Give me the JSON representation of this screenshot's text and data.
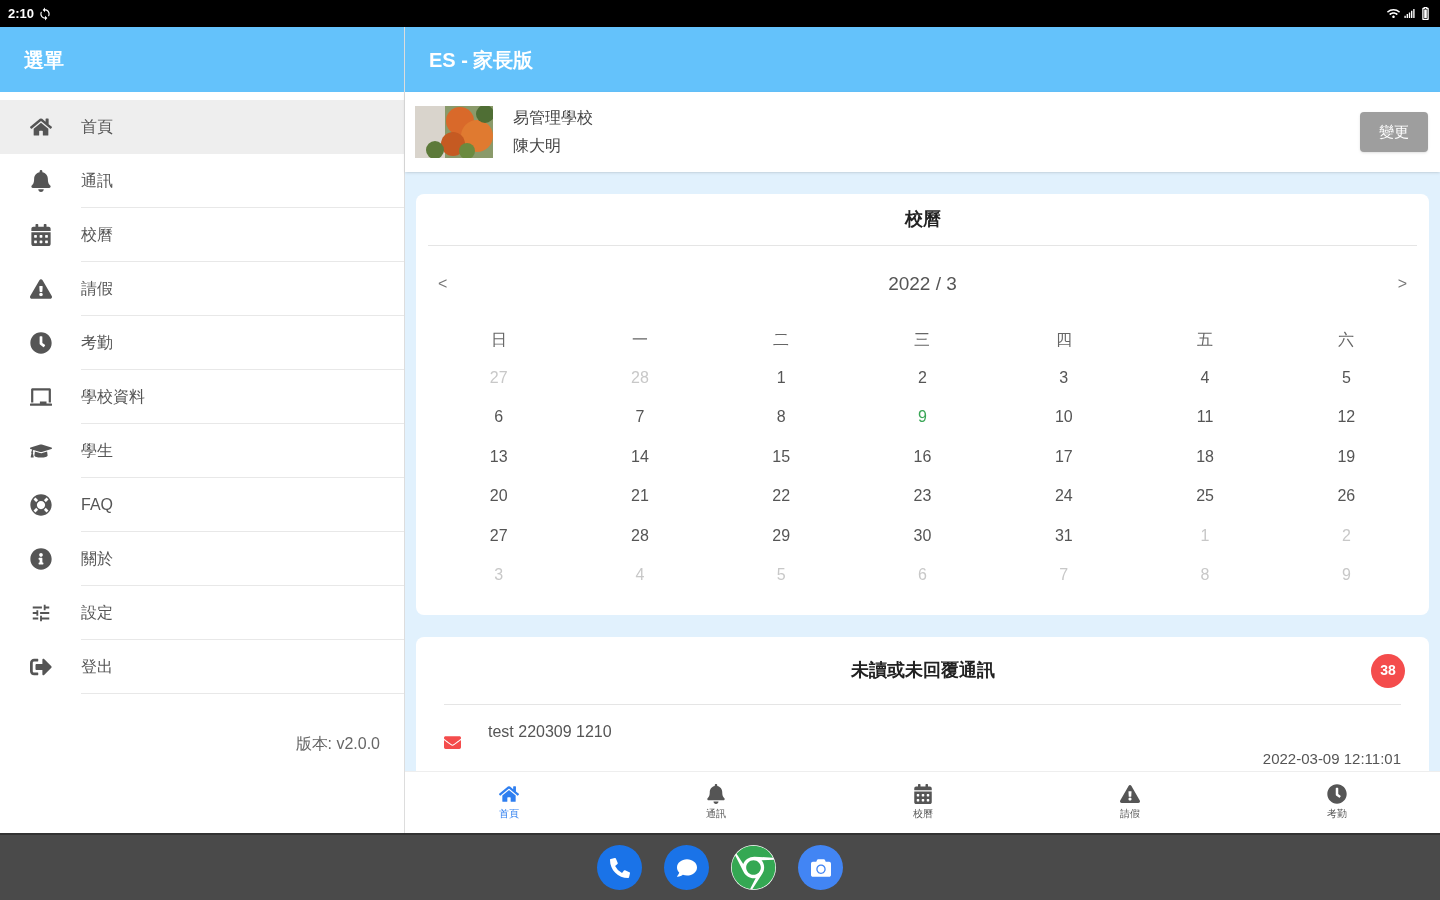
{
  "status_bar": {
    "time": "2:10"
  },
  "sidebar": {
    "title": "選單",
    "items": [
      {
        "label": "首頁",
        "selected": true
      },
      {
        "label": "通訊",
        "selected": false
      },
      {
        "label": "校曆",
        "selected": false
      },
      {
        "label": "請假",
        "selected": false
      },
      {
        "label": "考勤",
        "selected": false
      },
      {
        "label": "學校資料",
        "selected": false
      },
      {
        "label": "學生",
        "selected": false
      },
      {
        "label": "FAQ",
        "selected": false
      },
      {
        "label": "關於",
        "selected": false
      },
      {
        "label": "設定",
        "selected": false
      },
      {
        "label": "登出",
        "selected": false
      }
    ],
    "version": "版本: v2.0.0"
  },
  "app_bar": {
    "title": "ES - 家長版"
  },
  "profile": {
    "school": "易管理學校",
    "student": "陳大明",
    "button": "變更"
  },
  "calendar": {
    "title": "校曆",
    "month": "2022 / 3",
    "prev": "<",
    "next": ">",
    "weekdays": [
      "日",
      "一",
      "二",
      "三",
      "四",
      "五",
      "六"
    ],
    "days": [
      {
        "label": "27",
        "kind": "outside"
      },
      {
        "label": "28",
        "kind": "outside"
      },
      {
        "label": "1",
        "kind": "inside"
      },
      {
        "label": "2",
        "kind": "inside"
      },
      {
        "label": "3",
        "kind": "inside"
      },
      {
        "label": "4",
        "kind": "inside"
      },
      {
        "label": "5",
        "kind": "inside"
      },
      {
        "label": "6",
        "kind": "inside"
      },
      {
        "label": "7",
        "kind": "inside"
      },
      {
        "label": "8",
        "kind": "inside"
      },
      {
        "label": "9",
        "kind": "today"
      },
      {
        "label": "10",
        "kind": "inside"
      },
      {
        "label": "11",
        "kind": "inside"
      },
      {
        "label": "12",
        "kind": "inside"
      },
      {
        "label": "13",
        "kind": "inside"
      },
      {
        "label": "14",
        "kind": "inside"
      },
      {
        "label": "15",
        "kind": "inside"
      },
      {
        "label": "16",
        "kind": "inside"
      },
      {
        "label": "17",
        "kind": "inside"
      },
      {
        "label": "18",
        "kind": "inside"
      },
      {
        "label": "19",
        "kind": "inside"
      },
      {
        "label": "20",
        "kind": "inside"
      },
      {
        "label": "21",
        "kind": "inside"
      },
      {
        "label": "22",
        "kind": "inside"
      },
      {
        "label": "23",
        "kind": "inside"
      },
      {
        "label": "24",
        "kind": "inside"
      },
      {
        "label": "25",
        "kind": "inside"
      },
      {
        "label": "26",
        "kind": "inside"
      },
      {
        "label": "27",
        "kind": "inside"
      },
      {
        "label": "28",
        "kind": "inside"
      },
      {
        "label": "29",
        "kind": "inside"
      },
      {
        "label": "30",
        "kind": "inside"
      },
      {
        "label": "31",
        "kind": "inside"
      },
      {
        "label": "1",
        "kind": "outside"
      },
      {
        "label": "2",
        "kind": "outside"
      },
      {
        "label": "3",
        "kind": "outside"
      },
      {
        "label": "4",
        "kind": "outside"
      },
      {
        "label": "5",
        "kind": "outside"
      },
      {
        "label": "6",
        "kind": "outside"
      },
      {
        "label": "7",
        "kind": "outside"
      },
      {
        "label": "8",
        "kind": "outside"
      },
      {
        "label": "9",
        "kind": "outside"
      }
    ]
  },
  "messages": {
    "title": "未讀或未回覆通訊",
    "count": "38",
    "items": [
      {
        "subject": "test 220309 1210",
        "time": "2022-03-09 12:11:01"
      }
    ]
  },
  "bottom_nav": [
    {
      "label": "首頁",
      "selected": true
    },
    {
      "label": "通訊",
      "selected": false
    },
    {
      "label": "校曆",
      "selected": false
    },
    {
      "label": "請假",
      "selected": false
    },
    {
      "label": "考勤",
      "selected": false
    }
  ]
}
